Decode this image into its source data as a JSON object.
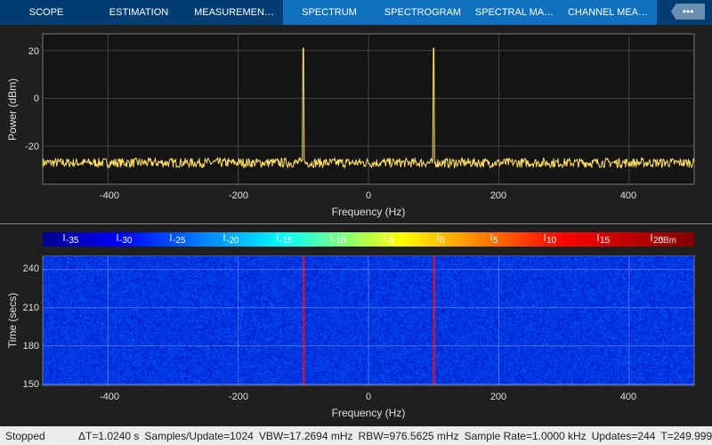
{
  "tabs": [
    {
      "label": "SCOPE",
      "selected": false
    },
    {
      "label": "ESTIMATION",
      "selected": false
    },
    {
      "label": "MEASUREMEN…",
      "selected": false
    },
    {
      "label": "SPECTRUM",
      "selected": true
    },
    {
      "label": "SPECTROGRAM",
      "selected": true
    },
    {
      "label": "SPECTRAL MA…",
      "selected": true
    },
    {
      "label": "CHANNEL MEA…",
      "selected": true
    }
  ],
  "more_label": "•••",
  "spectrum": {
    "ylabel": "Power (dBm)",
    "xlabel": "Frequency (Hz)",
    "yticks": [
      "20",
      "0",
      "-20"
    ],
    "xticks": [
      "-400",
      "-200",
      "0",
      "200",
      "400"
    ],
    "trace_color": "#ffe066",
    "noise_floor_dbm": -27,
    "tones_hz": [
      -100,
      100
    ],
    "tone_peak_dbm": 21,
    "ylim": [
      -36,
      27
    ],
    "xlim": [
      -500,
      500
    ]
  },
  "colorbar": {
    "ticks": [
      "-35",
      "-30",
      "-25",
      "-20",
      "-15",
      "-10",
      "-5",
      "0",
      "5",
      "10",
      "15",
      "20"
    ],
    "unit": "dBm",
    "range": [
      -37,
      24
    ]
  },
  "spectrogram": {
    "ylabel": "Time (secs)",
    "xlabel": "Frequency (Hz)",
    "yticks": [
      "240",
      "210",
      "180",
      "150"
    ],
    "xticks": [
      "-400",
      "-200",
      "0",
      "200",
      "400"
    ],
    "ylim": [
      149,
      251
    ],
    "xlim": [
      -500,
      500
    ]
  },
  "status": {
    "state": "Stopped",
    "items": [
      "ΔT=1.0240 s",
      "Samples/Update=1024",
      "VBW=17.2694 mHz",
      "RBW=976.5625 mHz",
      "Sample Rate=1.0000 kHz",
      "Updates=244",
      "T=249.999"
    ]
  }
}
